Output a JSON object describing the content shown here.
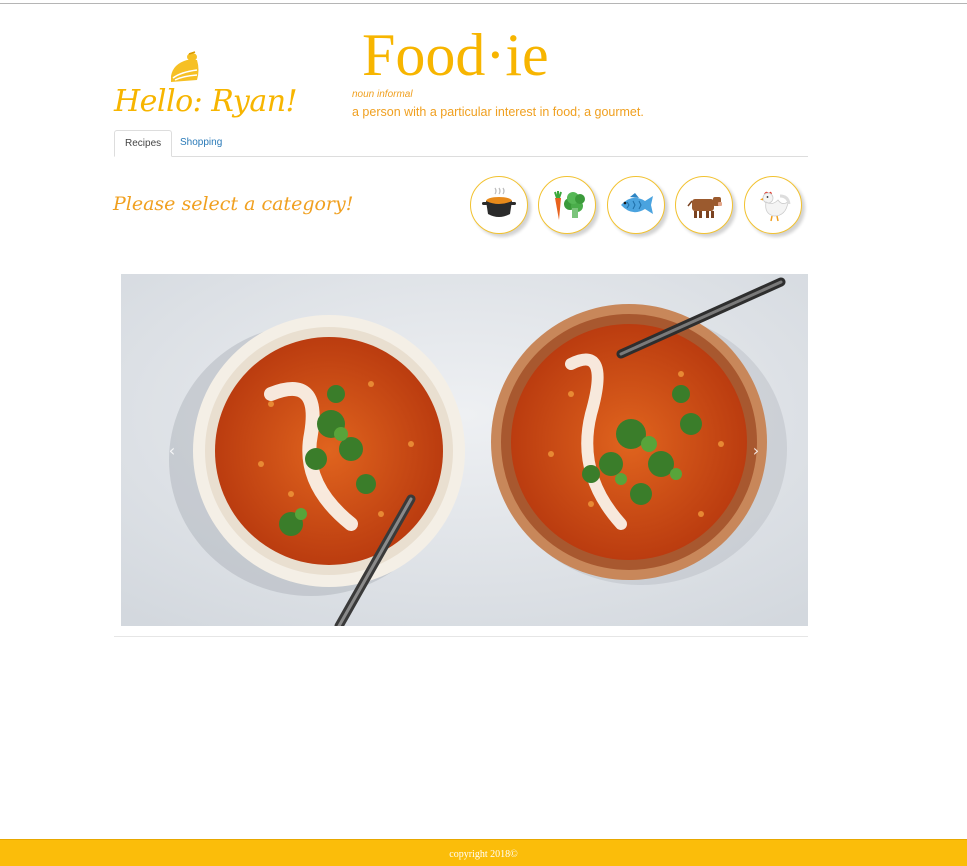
{
  "header": {
    "greeting": "Hello: Ryan!",
    "brand_title": "Food·ie",
    "part_of_speech": "noun informal",
    "definition": "a person with a particular interest in food; a gourmet."
  },
  "tabs": [
    {
      "label": "Recipes",
      "active": true
    },
    {
      "label": "Shopping",
      "active": false
    }
  ],
  "category": {
    "prompt": "Please select a category!",
    "options": [
      {
        "name": "soup",
        "icon": "cooking-pot-icon"
      },
      {
        "name": "vegetables",
        "icon": "vegetables-icon"
      },
      {
        "name": "fish",
        "icon": "fish-icon"
      },
      {
        "name": "beef",
        "icon": "cow-icon"
      },
      {
        "name": "chicken",
        "icon": "chicken-icon"
      }
    ]
  },
  "carousel": {
    "image": "two bowls of red lentil soup with cilantro and yogurt swirl",
    "prev_icon": "chevron-left-icon",
    "next_icon": "chevron-right-icon"
  },
  "footer": {
    "copyright": "copyright 2018©"
  },
  "colors": {
    "brand": "#f7b500",
    "footer": "#fbbd0a",
    "tab_link": "#2a7ab8"
  }
}
